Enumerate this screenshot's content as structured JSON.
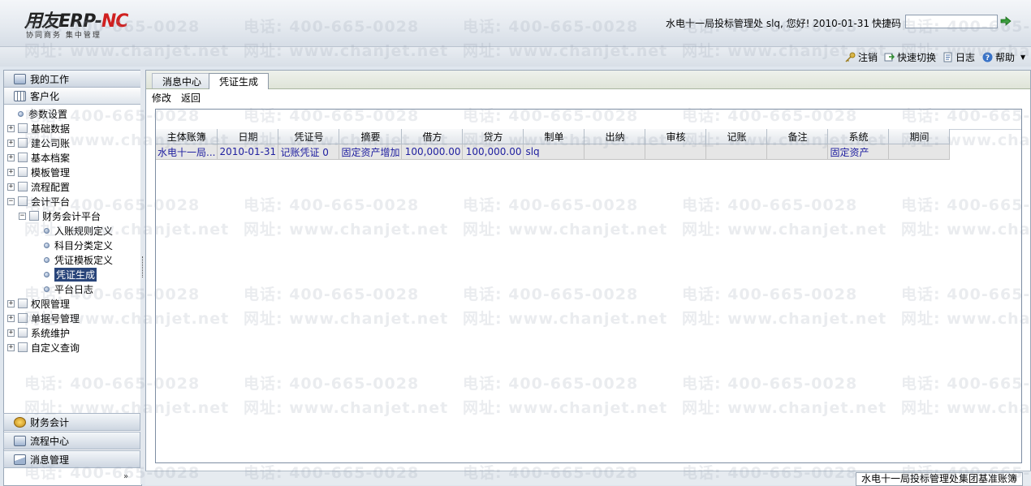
{
  "header": {
    "logo_main": "用友ERP-",
    "logo_accent": "NC",
    "logo_sub": "协同商务    集中管理",
    "greeting": "水电十一局投标管理处 slq, 您好! 2010-01-31",
    "shortcut_label": "快捷码",
    "shortcut_value": ""
  },
  "topbar": {
    "logout": "注销",
    "quick_switch": "快速切换",
    "log": "日志",
    "help": "帮助"
  },
  "left": {
    "accordion_top": [
      "我的工作",
      "客户化"
    ],
    "tree": [
      {
        "label": "参数设置",
        "level": 0,
        "kind": "leaf"
      },
      {
        "label": "基础数据",
        "level": 0,
        "kind": "folder"
      },
      {
        "label": "建公司账",
        "level": 0,
        "kind": "folder"
      },
      {
        "label": "基本档案",
        "level": 0,
        "kind": "folder"
      },
      {
        "label": "模板管理",
        "level": 0,
        "kind": "folder"
      },
      {
        "label": "流程配置",
        "level": 0,
        "kind": "folder"
      },
      {
        "label": "会计平台",
        "level": 0,
        "kind": "folder-open"
      },
      {
        "label": "财务会计平台",
        "level": 1,
        "kind": "folder-open"
      },
      {
        "label": "入账规则定义",
        "level": 2,
        "kind": "leaf"
      },
      {
        "label": "科目分类定义",
        "level": 2,
        "kind": "leaf"
      },
      {
        "label": "凭证模板定义",
        "level": 2,
        "kind": "leaf"
      },
      {
        "label": "凭证生成",
        "level": 2,
        "kind": "leaf",
        "selected": true
      },
      {
        "label": "平台日志",
        "level": 2,
        "kind": "leaf"
      },
      {
        "label": "权限管理",
        "level": 0,
        "kind": "folder"
      },
      {
        "label": "单据号管理",
        "level": 0,
        "kind": "folder"
      },
      {
        "label": "系统维护",
        "level": 0,
        "kind": "folder"
      },
      {
        "label": "自定义查询",
        "level": 0,
        "kind": "folder"
      }
    ],
    "accordion_bottom": [
      "财务会计",
      "流程中心",
      "消息管理"
    ]
  },
  "tabs": [
    "消息中心",
    "凭证生成"
  ],
  "actions": [
    "修改",
    "返回"
  ],
  "grid": {
    "columns": [
      "主体账簿",
      "日期",
      "凭证号",
      "摘要",
      "借方",
      "贷方",
      "制单",
      "出纳",
      "审核",
      "记账",
      "备注",
      "系统",
      "期间"
    ],
    "rows": [
      [
        "水电十一局...",
        "2010-01-31",
        "记账凭证  0",
        "固定资产增加",
        "100,000.00",
        "100,000.00",
        "slq",
        "",
        "",
        "",
        "",
        "固定资产",
        ""
      ]
    ]
  },
  "status": "水电十一局投标管理处集团基准账簿",
  "watermark": {
    "phone": "电话: 400-665-0028",
    "site": "网址: www.chanjet.net"
  }
}
